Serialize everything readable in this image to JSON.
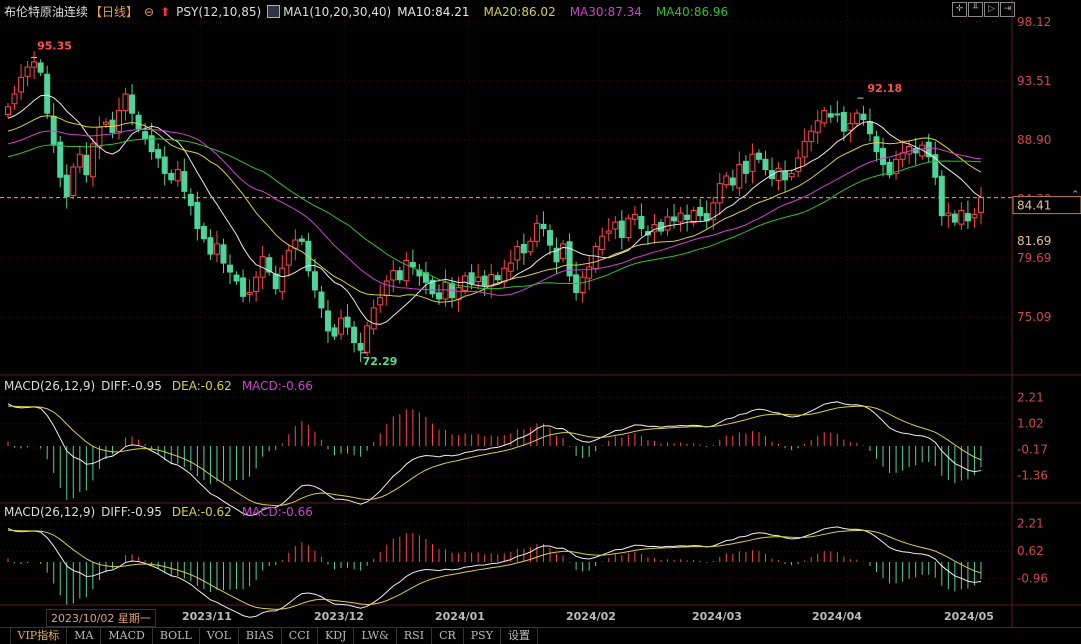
{
  "header": {
    "instrument": "布伦特原油连续",
    "period": "【日线】",
    "indicator": "PSY(12,10,85)",
    "ma_label": "MA1(10,20,30,40)",
    "ma10": "MA10:84.21",
    "ma20": "MA20:86.02",
    "ma30": "MA30:87.34",
    "ma40": "MA40:86.96"
  },
  "toolbar": {
    "icons": [
      "crosshair-icon",
      "zoom-in-icon",
      "zoom-out-icon",
      "move-right-icon"
    ]
  },
  "macd_panels": [
    {
      "title": "MACD(26,12,9)",
      "diff": "DIFF:-0.95",
      "dea": "DEA:-0.62",
      "macd": "MACD:-0.66",
      "axis": [
        "2.21",
        "1.02",
        "-0.17",
        "-1.36"
      ]
    },
    {
      "title": "MACD(26,12,9)",
      "diff": "DIFF:-0.95",
      "dea": "DEA:-0.62",
      "macd": "MACD:-0.66",
      "axis": [
        "2.21",
        "0.62",
        "-0.96"
      ]
    }
  ],
  "dates": {
    "cursor": "2023/10/02 星期一",
    "months": [
      "2023/11",
      "2023/12",
      "2024/01",
      "2024/02",
      "2024/03",
      "2024/04",
      "2024/05"
    ]
  },
  "tabs": [
    "VIP指标",
    "MA",
    "MACD",
    "BOLL",
    "VOL",
    "BIAS",
    "CCI",
    "KDJ",
    "LW&",
    "RSI",
    "CR",
    "PSY",
    "设置"
  ],
  "colors": {
    "up": "#ff4646",
    "down": "#4fd49a",
    "ma10": "#e8e8e8",
    "ma20": "#d8d040",
    "ma30": "#d040d0",
    "ma40": "#30c030",
    "axis": "#d04848"
  },
  "chart_data": {
    "type": "candlestick",
    "title": "布伦特原油连续 日线",
    "price_axis_ticks": [
      "98.12",
      "93.51",
      "88.90",
      "84.30",
      "79.69",
      "75.09"
    ],
    "ylim": [
      72.0,
      98.12
    ],
    "last_price": "84.41",
    "cursor_price": "81.69",
    "annotations": [
      {
        "label": "95.35",
        "index": 4,
        "type": "high"
      },
      {
        "label": "72.29",
        "index": 54,
        "type": "low"
      },
      {
        "label": "92.18",
        "index": 131,
        "type": "high"
      }
    ],
    "closes": [
      91.5,
      92.5,
      93.8,
      94.6,
      95.0,
      94.2,
      91.0,
      88.5,
      86.0,
      84.5,
      86.8,
      87.8,
      86.2,
      88.6,
      89.9,
      90.3,
      89.5,
      91.2,
      92.5,
      91.0,
      89.8,
      89.0,
      88.0,
      87.5,
      86.3,
      85.8,
      86.6,
      84.9,
      83.8,
      82.0,
      81.2,
      80.0,
      80.8,
      79.3,
      78.6,
      77.9,
      76.7,
      77.0,
      78.2,
      79.8,
      78.6,
      77.3,
      78.9,
      80.3,
      81.1,
      81.0,
      78.7,
      77.2,
      75.8,
      74.0,
      73.6,
      75.0,
      74.3,
      73.1,
      72.5,
      74.4,
      75.8,
      76.6,
      77.9,
      78.7,
      78.0,
      79.5,
      79.0,
      78.3,
      77.8,
      76.9,
      76.5,
      77.8,
      76.6,
      77.4,
      78.3,
      77.7,
      78.2,
      77.5,
      78.4,
      78.0,
      78.9,
      79.3,
      80.6,
      80.1,
      81.0,
      82.4,
      82.0,
      80.7,
      79.4,
      80.8,
      78.3,
      77.0,
      78.2,
      79.0,
      80.6,
      81.4,
      81.8,
      82.5,
      81.3,
      82.8,
      83.1,
      82.0,
      81.5,
      82.3,
      81.8,
      82.9,
      82.6,
      83.2,
      82.7,
      83.4,
      83.0,
      82.6,
      84.0,
      85.5,
      86.1,
      85.4,
      87.0,
      86.3,
      87.8,
      87.4,
      86.6,
      85.9,
      86.7,
      85.8,
      86.3,
      87.5,
      88.8,
      89.6,
      90.4,
      91.2,
      90.7,
      90.9,
      89.6,
      90.2,
      91.0,
      90.5,
      89.4,
      88.0,
      87.0,
      86.2,
      87.4,
      87.9,
      88.4,
      87.9,
      88.5,
      87.6,
      86.0,
      83.0,
      83.2,
      82.5,
      83.4,
      82.6,
      83.1,
      84.41
    ],
    "ma_periods": [
      10,
      20,
      30,
      40
    ],
    "macd_params": [
      26,
      12,
      9
    ]
  }
}
